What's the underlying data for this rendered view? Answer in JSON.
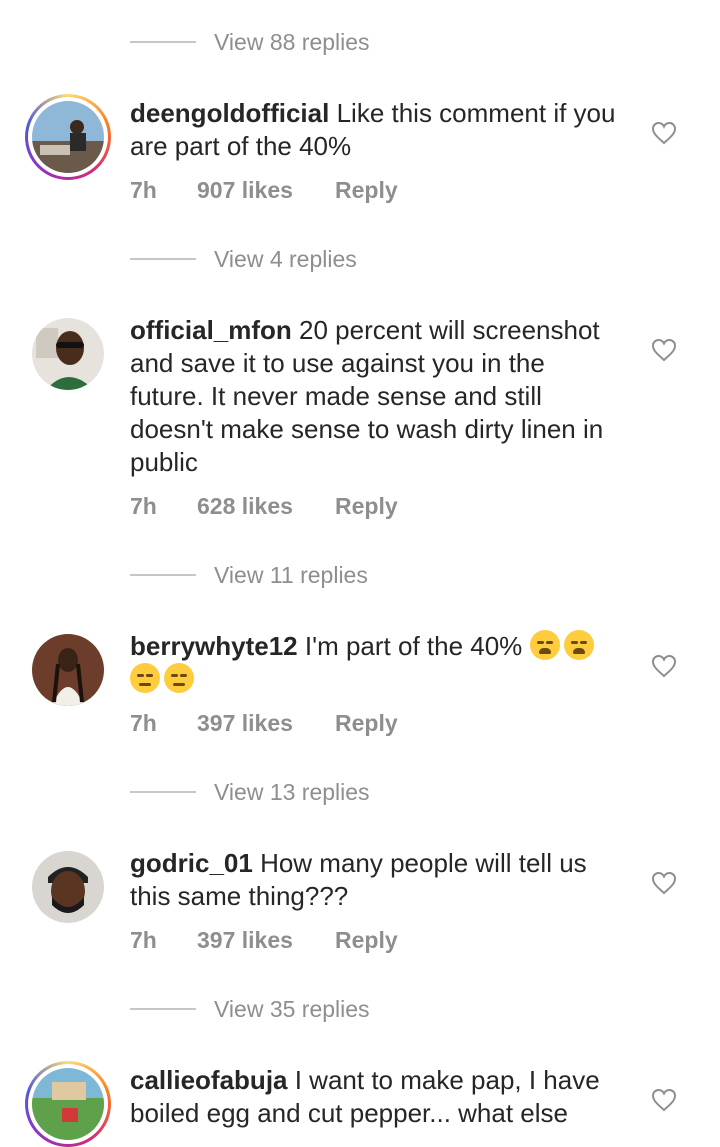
{
  "view_replies": [
    "View 88 replies",
    "View 4 replies",
    "View 11 replies",
    "View 13 replies",
    "View 35 replies"
  ],
  "comments": [
    {
      "username": "deengoldofficial",
      "text": "Like this comment if you are part of the 40%",
      "time": "7h",
      "likes": "907 likes",
      "reply": "Reply"
    },
    {
      "username": "official_mfon",
      "text": "20 percent will screenshot and save it to use against you in the future. It never made sense and still doesn't make sense to wash dirty linen in public",
      "time": "7h",
      "likes": "628 likes",
      "reply": "Reply"
    },
    {
      "username": "berrywhyte12",
      "text": "I'm part of the 40%",
      "emojis": [
        "weary-face-emoji",
        "weary-face-emoji",
        "pensive-face-emoji",
        "pensive-face-emoji"
      ],
      "time": "7h",
      "likes": "397 likes",
      "reply": "Reply"
    },
    {
      "username": "godric_01",
      "text": "How many people will tell us this same thing???",
      "time": "7h",
      "likes": "397 likes",
      "reply": "Reply"
    },
    {
      "username": "callieofabuja",
      "text": "I want to make pap, I have boiled egg and cut pepper... what else"
    }
  ],
  "colors": {
    "text": "#262626",
    "muted": "#8e8e8e",
    "divider": "#c7c7c7"
  }
}
